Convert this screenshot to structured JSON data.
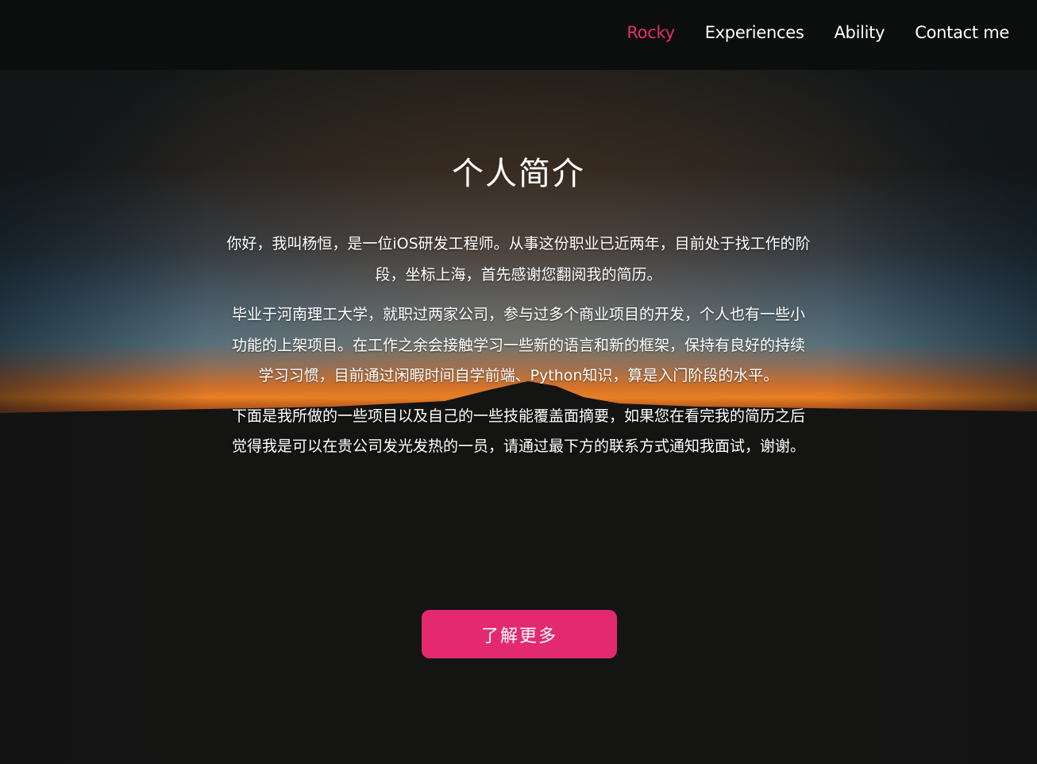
{
  "nav": {
    "items": [
      {
        "label": "Rocky",
        "active": true
      },
      {
        "label": "Experiences",
        "active": false
      },
      {
        "label": "Ability",
        "active": false
      },
      {
        "label": "Contact me",
        "active": false
      }
    ]
  },
  "intro": {
    "title": "个人简介",
    "paragraphs": [
      "你好，我叫杨恒，是一位iOS研发工程师。从事这份职业已近两年，目前处于找工作的阶段，坐标上海，首先感谢您翻阅我的简历。",
      "毕业于河南理工大学，就职过两家公司，参与过多个商业项目的开发，个人也有一些小功能的上架项目。在工作之余会接触学习一些新的语言和新的框架，保持有良好的持续学习习惯，目前通过闲暇时间自学前端、Python知识，算是入门阶段的水平。",
      "下面是我所做的一些项目以及自己的一些技能覆盖面摘要，如果您在看完我的简历之后觉得我是可以在贵公司发光发热的一员，请通过最下方的联系方式通知我面试，谢谢。"
    ],
    "cta_label": "了解更多"
  },
  "colors": {
    "accent": "#e32a70",
    "nav_active": "#e3306f",
    "navbar_bg": "#0c0d0d",
    "page_bg": "#111413"
  }
}
